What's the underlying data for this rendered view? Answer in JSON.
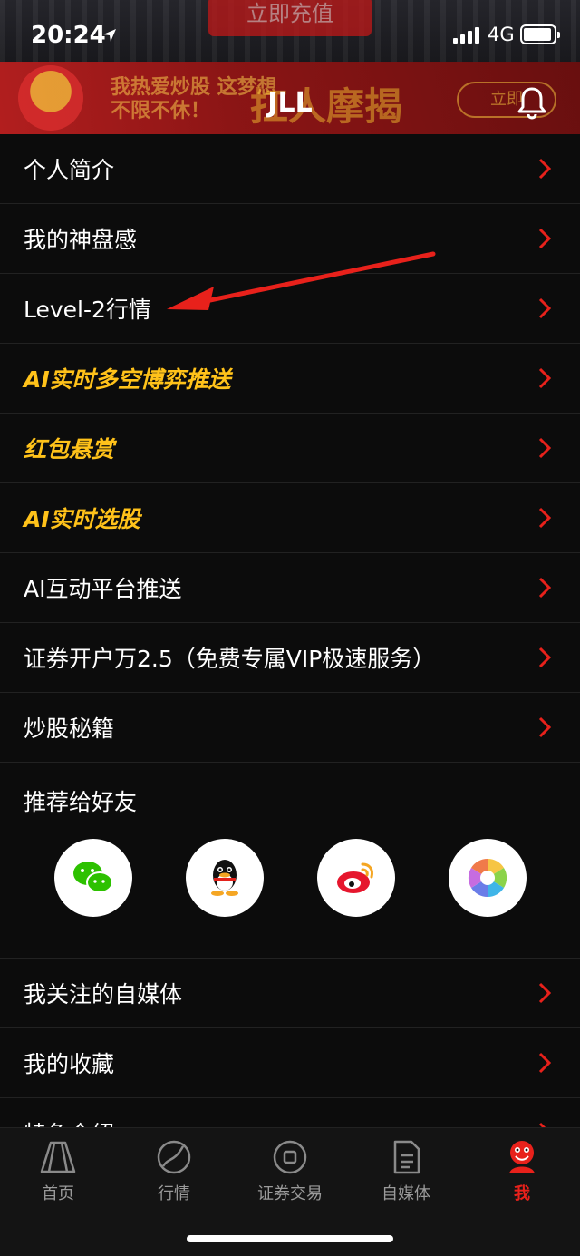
{
  "status_bar": {
    "time": "20:24",
    "network": "4G"
  },
  "banner": {
    "recharge_text": "立即充值",
    "slogan": "我热爱炒股 这梦想不限不休！",
    "headline": "扛人摩揭",
    "cta": "立即"
  },
  "header": {
    "title": "JLL"
  },
  "menu": [
    {
      "label": "个人简介",
      "style": "normal"
    },
    {
      "label": "我的神盘感",
      "style": "normal"
    },
    {
      "label": "Level-2行情",
      "style": "normal"
    },
    {
      "label": "AI实时多空博弈推送",
      "style": "gold"
    },
    {
      "label": "红包悬赏",
      "style": "gold"
    },
    {
      "label": "AI实时选股",
      "style": "gold"
    },
    {
      "label": "AI互动平台推送",
      "style": "normal"
    },
    {
      "label": "证券开户万2.5（免费专属VIP极速服务）",
      "style": "normal"
    },
    {
      "label": "炒股秘籍",
      "style": "normal"
    }
  ],
  "share": {
    "label": "推荐给好友",
    "targets": [
      "wechat-icon",
      "qq-icon",
      "weibo-icon",
      "moments-icon"
    ]
  },
  "menu2": [
    {
      "label": "我关注的自媒体"
    },
    {
      "label": "我的收藏"
    },
    {
      "label": "特色介绍"
    }
  ],
  "tabs": [
    {
      "label": "首页",
      "icon": "home-icon"
    },
    {
      "label": "行情",
      "icon": "market-icon"
    },
    {
      "label": "证券交易",
      "icon": "trade-icon"
    },
    {
      "label": "自媒体",
      "icon": "media-icon"
    },
    {
      "label": "我",
      "icon": "profile-icon",
      "active": true
    }
  ],
  "colors": {
    "accent": "#e8211b",
    "gold": "#ffc21a",
    "background": "#0c0c0c"
  }
}
